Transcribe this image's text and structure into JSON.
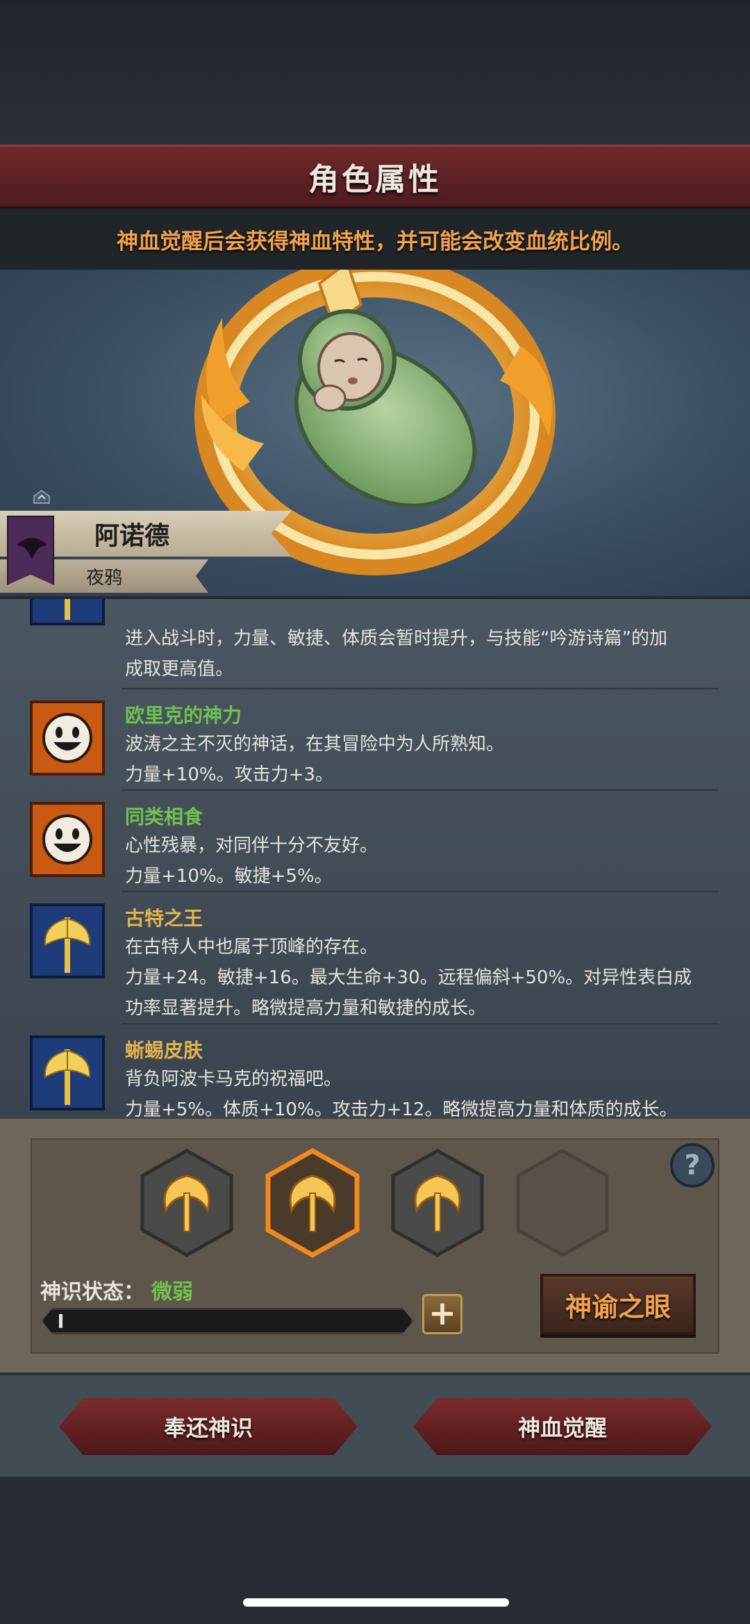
{
  "header": {
    "title": "角色属性",
    "notice": "神血觉醒后会获得神血特性，并可能会改变血统比例。"
  },
  "character": {
    "name": "阿诺德",
    "clan": "夜鸦",
    "emblem_icon": "crow-banner-icon",
    "portrait": "swaddled-baby-in-flame-ring"
  },
  "traits": [
    {
      "icon": "golden-axe-icon",
      "name": "",
      "lines": [
        "进入战斗时，力量、敏捷、体质会暂时提升，与技能“吟游诗篇”的加",
        "成取更高值。"
      ]
    },
    {
      "icon": "smiley-face-icon",
      "name": "欧里克的神力",
      "name_color": "#6ec24f",
      "lines": [
        "波涛之主不灭的神话，在其冒险中为人所熟知。",
        "力量+10%。攻击力+3。"
      ]
    },
    {
      "icon": "smiley-face-icon",
      "name": "同类相食",
      "name_color": "#6ec24f",
      "lines": [
        "心性残暴，对同伴十分不友好。",
        "力量+10%。敏捷+5%。"
      ]
    },
    {
      "icon": "golden-axe-icon",
      "name": "古特之王",
      "name_color": "#e3b34d",
      "lines": [
        "在古特人中也属于顶峰的存在。",
        "力量+24。敏捷+16。最大生命+30。远程偏斜+50%。对异性表白成",
        "功率显著提升。略微提高力量和敏捷的成长。"
      ]
    },
    {
      "icon": "golden-axe-icon",
      "name": "蜥蜴皮肤",
      "name_color": "#e3b34d",
      "lines": [
        "背负阿波卡马克的祝福吧。",
        "力量+5%。体质+10%。攻击力+12。略微提高力量和体质的成长。"
      ]
    }
  ],
  "divine": {
    "status_label": "神识状态：",
    "status_value": "微弱",
    "status_color": "#6ec24f",
    "progress": 0.01,
    "slots": [
      "flame-trident-icon",
      "flame-trident-icon",
      "flame-trident-icon",
      "empty-slot"
    ],
    "selected_slot": 2,
    "plus_label": "+",
    "help_label": "?",
    "oracle_button": "神谕之眼"
  },
  "actions": {
    "return_button": "奉还神识",
    "awaken_button": "神血觉醒"
  }
}
